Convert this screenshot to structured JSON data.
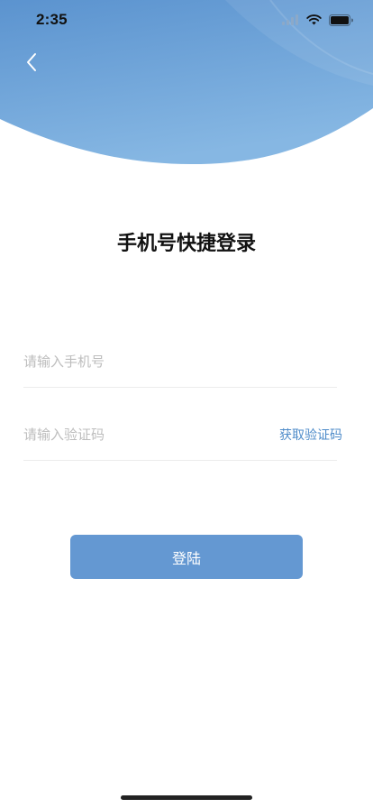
{
  "colors": {
    "header_gradient_start": "#5b93cf",
    "header_gradient_end": "#86b7e3",
    "accent": "#4e8bc9",
    "button": "#6498d2",
    "title": "#111111",
    "placeholder": "#bdbdbd"
  },
  "status_bar": {
    "time": "2:35",
    "icons": [
      "signal-icon",
      "wifi-icon",
      "battery-icon"
    ]
  },
  "nav": {
    "back_icon": "chevron-left-icon"
  },
  "page": {
    "title": "手机号快捷登录"
  },
  "form": {
    "phone_placeholder": "请输入手机号",
    "phone_value": "",
    "code_placeholder": "请输入验证码",
    "code_value": "",
    "get_code_label": "获取验证码",
    "login_label": "登陆"
  }
}
